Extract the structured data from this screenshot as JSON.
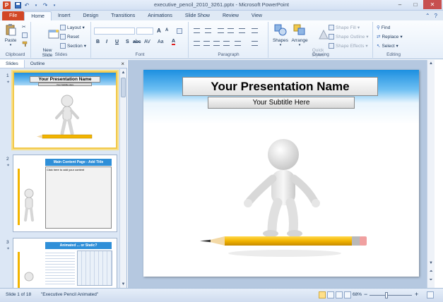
{
  "window": {
    "app_letter": "P",
    "title": "executive_pencil_2010_3261.pptx - Microsoft PowerPoint",
    "minimize": "–",
    "maximize": "□",
    "close": "✕"
  },
  "ribbon_tabs": [
    "File",
    "Home",
    "Insert",
    "Design",
    "Transitions",
    "Animations",
    "Slide Show",
    "Review",
    "View"
  ],
  "ribbon": {
    "clipboard": {
      "paste": "Paste",
      "label": "Clipboard"
    },
    "slides": {
      "new_slide": "New\nSlide",
      "layout": "Layout",
      "reset": "Reset",
      "section": "Section",
      "label": "Slides"
    },
    "font": {
      "bold": "B",
      "italic": "I",
      "underline": "U",
      "strike": "S",
      "shadow": "abc",
      "spacing": "AV",
      "case": "Aa",
      "color": "A",
      "grow": "A",
      "shrink": "A",
      "label": "Font"
    },
    "paragraph": {
      "label": "Paragraph"
    },
    "drawing": {
      "shapes": "Shapes",
      "arrange": "Arrange",
      "quick_styles": "Quick\nStyles",
      "shape_fill": "Shape Fill",
      "shape_outline": "Shape Outline",
      "shape_effects": "Shape Effects",
      "label": "Drawing"
    },
    "editing": {
      "find": "Find",
      "replace": "Replace",
      "select": "Select",
      "label": "Editing"
    }
  },
  "left_pane": {
    "tabs": [
      "Slides",
      "Outline"
    ],
    "close": "×",
    "thumbnails": [
      {
        "number": "1",
        "title": "Your Presentation Name",
        "subtitle": "Your Subtitle Here"
      },
      {
        "number": "2",
        "title": "Main Content Page - Add Title",
        "body": "Click here to add your content"
      },
      {
        "number": "3",
        "title": "Animated ... or Static?"
      }
    ]
  },
  "slide": {
    "title": "Your Presentation Name",
    "subtitle": "Your Subtitle Here"
  },
  "status_bar": {
    "slide_info": "Slide 1 of 18",
    "theme": "\"Executive Pencil Animated\"",
    "zoom": "68%"
  },
  "colors": {
    "file_tab": "#d24726",
    "slide_band_top": "#1c8fe0",
    "pencil": "#f2b400"
  }
}
